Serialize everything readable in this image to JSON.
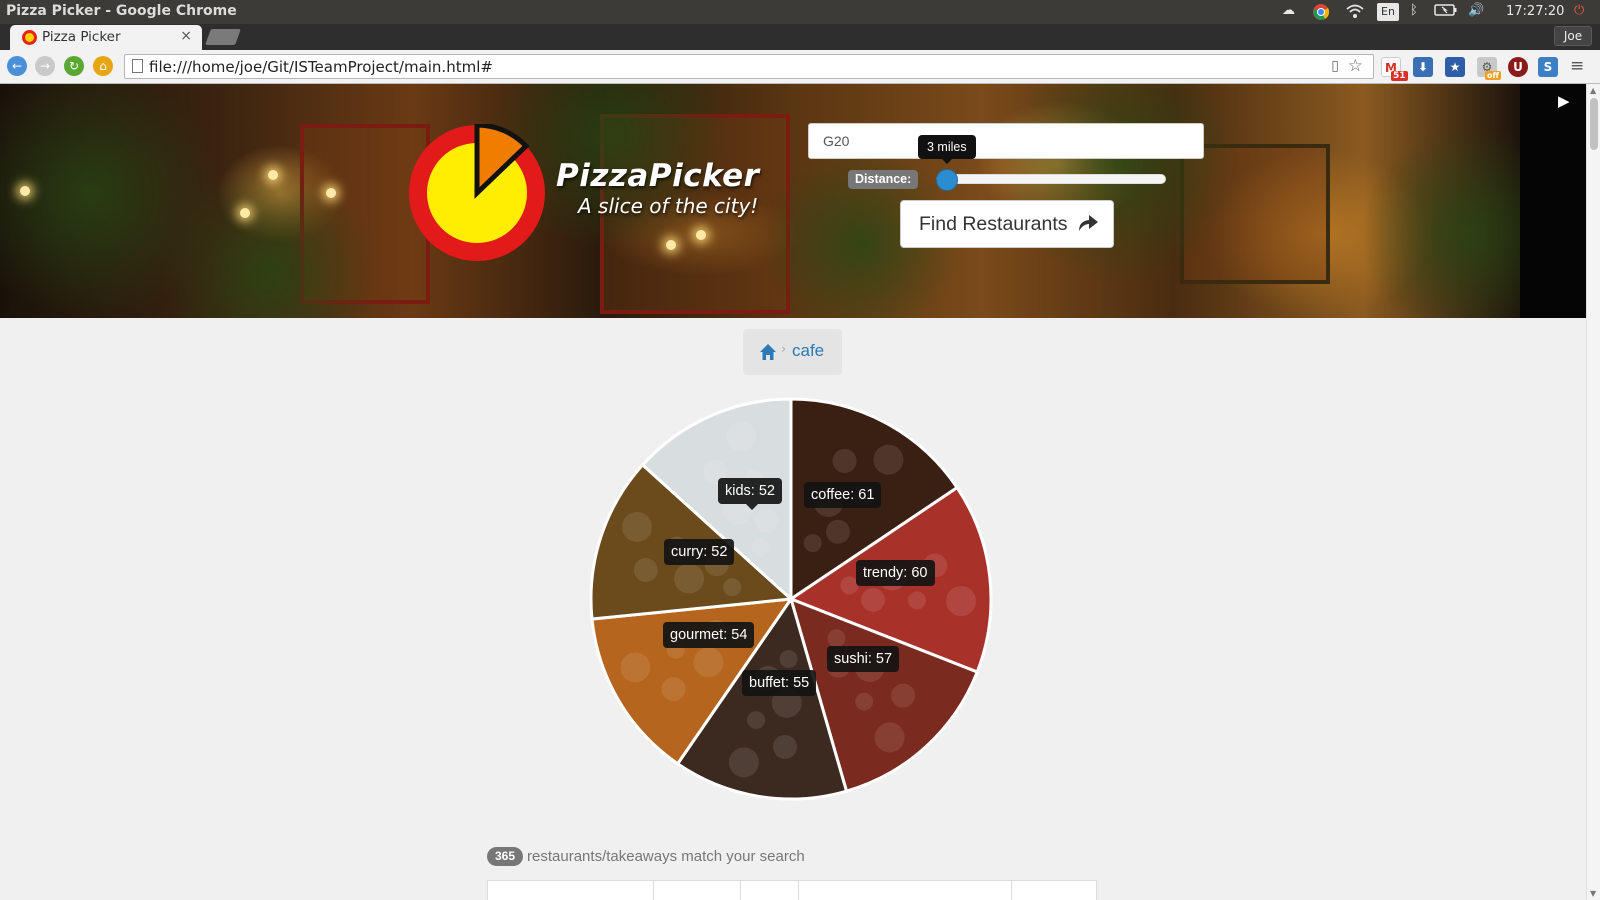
{
  "os": {
    "window_title": "Pizza Picker - Google Chrome",
    "clock": "17:27:20",
    "user": "Joe",
    "tray_keyboard": "En"
  },
  "browser": {
    "tab_title": "Pizza Picker",
    "tab_close": "×",
    "url": "file:///home/joe/Git/ISTeamProject/main.html#",
    "gmail_count": "51",
    "ext_off_badge": "off",
    "ublock_letter": "U"
  },
  "hero": {
    "brand": "PizzaPicker",
    "tagline": "A slice of the city!",
    "postcode_value": "G20",
    "distance_label": "Distance:",
    "distance_tooltip": "3 miles",
    "distance_fraction": 0.0,
    "find_button": "Find Restaurants",
    "next_arrow": "▶"
  },
  "breadcrumb": {
    "current": "cafe",
    "separator": "›"
  },
  "chart_data": {
    "type": "pie",
    "slices": [
      {
        "label": "coffee",
        "value": 61,
        "text": "coffee: 61",
        "color": "#3a2012"
      },
      {
        "label": "trendy",
        "value": 60,
        "text": "trendy: 60",
        "color": "#a8322a"
      },
      {
        "label": "sushi",
        "value": 57,
        "text": "sushi: 57",
        "color": "#7a2a1e"
      },
      {
        "label": "buffet",
        "value": 55,
        "text": "buffet: 55",
        "color": "#3c2a20"
      },
      {
        "label": "gourmet",
        "value": 54,
        "text": "gourmet: 54",
        "color": "#b5651d"
      },
      {
        "label": "curry",
        "value": 52,
        "text": "curry: 52",
        "color": "#6b4a1c"
      },
      {
        "label": "kids",
        "value": 52,
        "text": "kids: 52",
        "color": "#d8dde0"
      }
    ]
  },
  "results": {
    "count": "365",
    "text": "restaurants/takeaways match your search"
  }
}
